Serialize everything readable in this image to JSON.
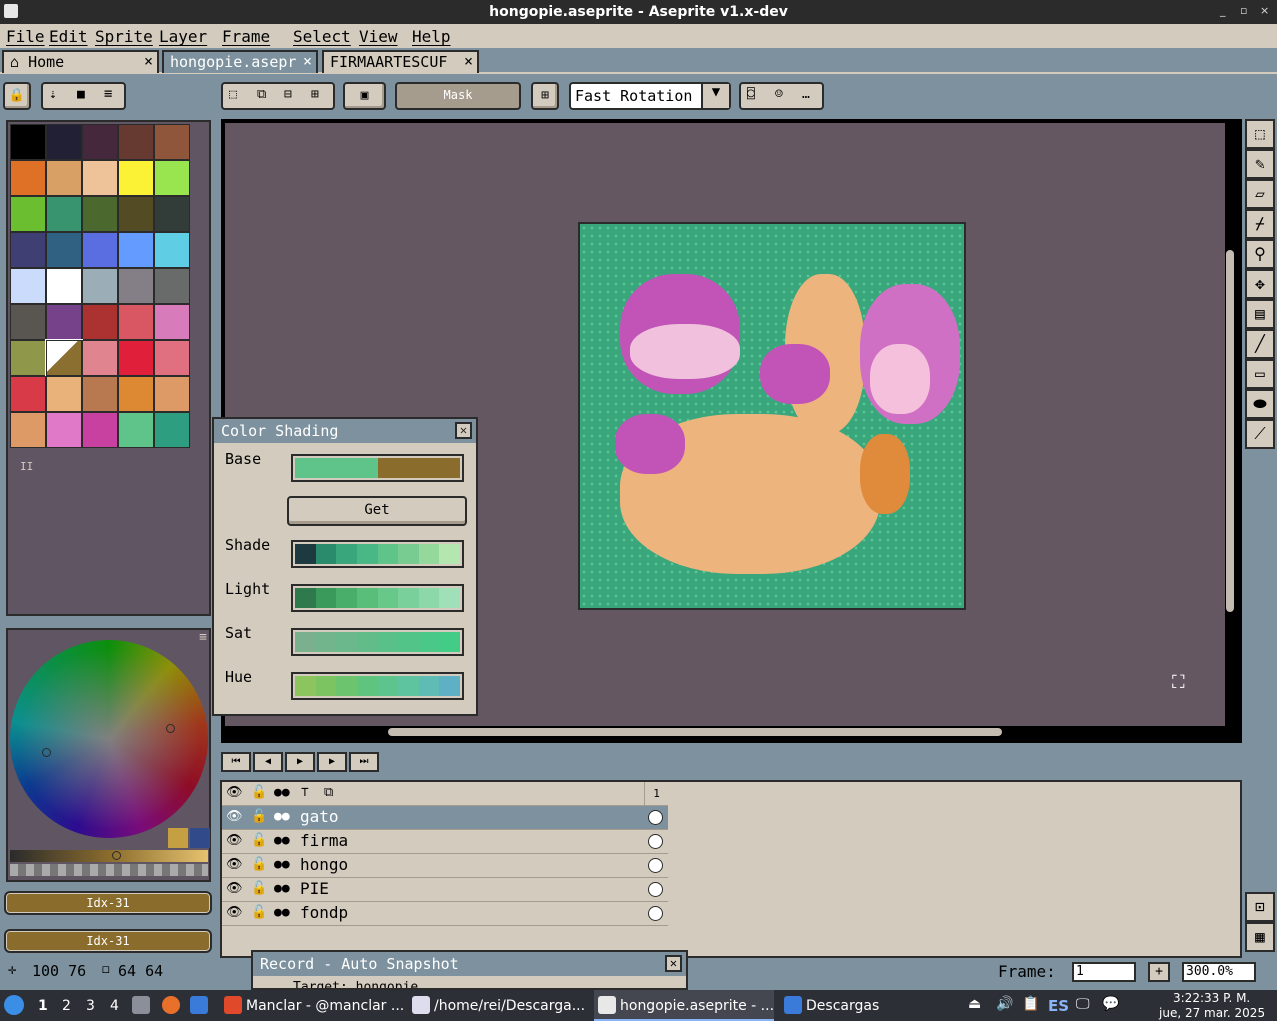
{
  "window": {
    "title": "hongopie.aseprite - Aseprite v1.x-dev",
    "controls": [
      "_",
      "▫",
      "×"
    ]
  },
  "menu": [
    "File",
    "Edit",
    "Sprite",
    "Layer",
    "Frame",
    "Select",
    "View",
    "Help"
  ],
  "tabs": [
    {
      "label": "Home",
      "icon": "home-icon",
      "active": false
    },
    {
      "label": "hongopie.asepr",
      "active": true
    },
    {
      "label": "FIRMAARTESCUF",
      "active": false
    }
  ],
  "toolbar": {
    "mask_label": "Mask",
    "rotation_algorithm": "Fast Rotation"
  },
  "palette": {
    "colors": [
      "#000000",
      "#222034",
      "#45283c",
      "#663931",
      "#8f563b",
      "#df7126",
      "#d9a066",
      "#eec39a",
      "#fbf236",
      "#99e550",
      "#6abe30",
      "#37946e",
      "#4b692f",
      "#524b24",
      "#323c39",
      "#3f3f74",
      "#306082",
      "#5b6ee1",
      "#639bff",
      "#5fcde4",
      "#cbdbfc",
      "#ffffff",
      "#9badb7",
      "#847e87",
      "#696a6a",
      "#595652",
      "#76428a",
      "#ac3232",
      "#d95763",
      "#d77bba",
      "#8f974a",
      "#8a6f30",
      "#e0848f",
      "#e0203a",
      "#e07080",
      "#d83a48",
      "#e8b27a",
      "#b87850",
      "#dd8833",
      "#dd9a66",
      "#dd9966",
      "#e07ac8",
      "#c840a0",
      "#5ec48a",
      "#2e9e80"
    ],
    "selected_index": 31,
    "entry_label": "II"
  },
  "color_indicators": {
    "foreground": "Idx-31",
    "background": "Idx-31",
    "color": "#8a6c2c"
  },
  "color_shading": {
    "title": "Color Shading",
    "base_label": "Base",
    "base_colors": [
      "#5ec48a",
      "#8a6c2c"
    ],
    "get_button": "Get",
    "shade_label": "Shade",
    "shade": [
      "#1c3a40",
      "#2a8a6c",
      "#3aa67c",
      "#4ab886",
      "#5ec48a",
      "#78cc92",
      "#94d89c",
      "#b4e6b0"
    ],
    "light_label": "Light",
    "light": [
      "#2e7a4c",
      "#3a9a5c",
      "#48ae6a",
      "#58be7a",
      "#68c88a",
      "#7ad09a",
      "#8cd8a8",
      "#a0e0b8"
    ],
    "sat_label": "Sat",
    "sat": [
      "#7ab08e",
      "#72b48c",
      "#6ab88c",
      "#62bc8a",
      "#5ac08a",
      "#52c488",
      "#4ac888",
      "#42cc86"
    ],
    "hue_label": "Hue",
    "hue": [
      "#8cc45e",
      "#7cc462",
      "#6cc46e",
      "#5ec47e",
      "#5ec48e",
      "#5ec4a0",
      "#5ebcb4",
      "#5eb0c4"
    ]
  },
  "layers": [
    {
      "name": "gato",
      "selected": true
    },
    {
      "name": "firma",
      "selected": false
    },
    {
      "name": "hongo",
      "selected": false
    },
    {
      "name": "PIE",
      "selected": false
    },
    {
      "name": "fondp",
      "selected": false
    }
  ],
  "timeline": {
    "frame_header": "1"
  },
  "record_window": {
    "title": "Record - Auto Snapshot",
    "partial_text": "Target: hongopie"
  },
  "status": {
    "position": "100 76",
    "size": "64 64",
    "frame_label": "Frame:",
    "frame_value": "1",
    "zoom": "300.0%"
  },
  "taskbar": {
    "workspaces": [
      "1",
      "2",
      "3",
      "4"
    ],
    "tasks": [
      "Manclar - @manclar ...",
      "/home/rei/Descarga...",
      "hongopie.aseprite - ...",
      "Descargas"
    ],
    "lang": "ES",
    "time": "3:22:33 P. M.",
    "date": "jue, 27 mar. 2025"
  }
}
